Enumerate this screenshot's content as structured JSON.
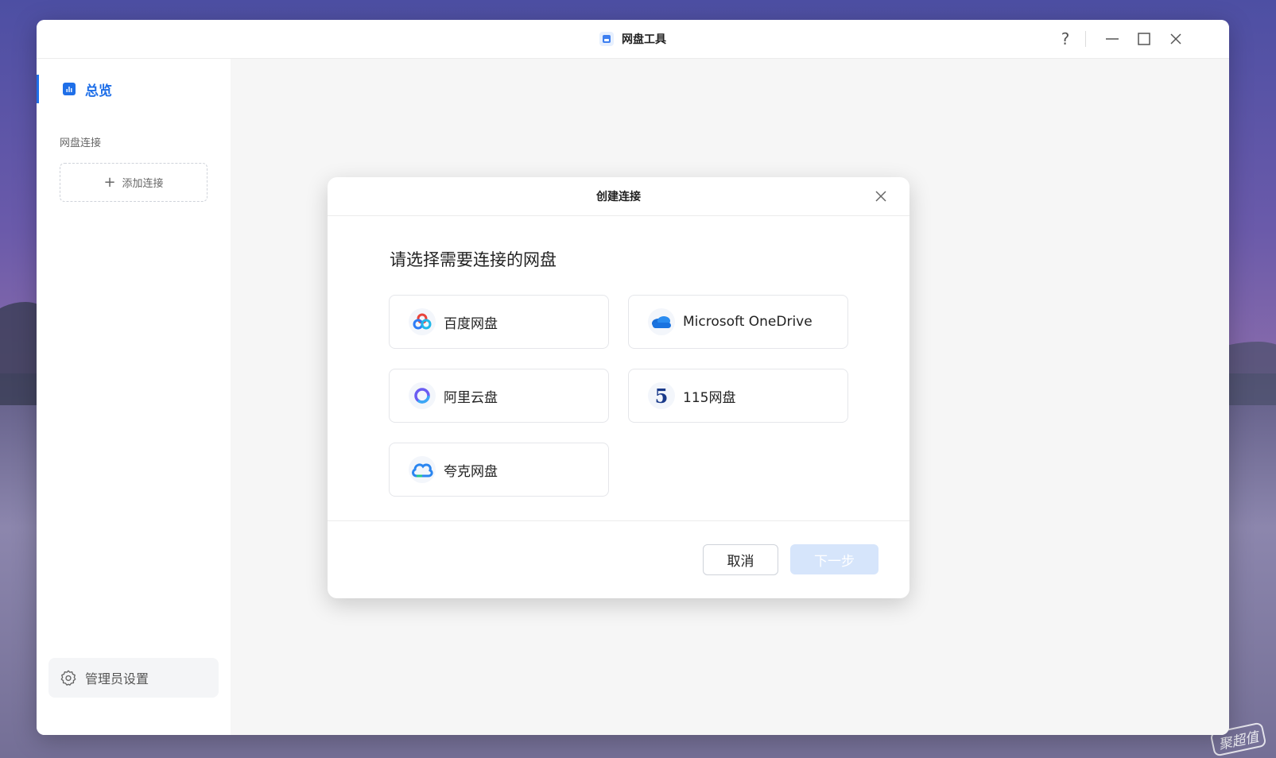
{
  "window": {
    "title": "网盘工具",
    "controls": {
      "help": "?",
      "minimize_icon": "minimize-icon",
      "maximize_icon": "maximize-icon",
      "close_icon": "close-icon"
    }
  },
  "sidebar": {
    "overview_label": "总览",
    "section_label": "网盘连接",
    "add_connection_label": "添加连接",
    "admin_settings_label": "管理员设置"
  },
  "modal": {
    "title": "创建连接",
    "prompt": "请选择需要连接的网盘",
    "providers": [
      {
        "name": "百度网盘",
        "icon": "baidu-netdisk-icon"
      },
      {
        "name": "Microsoft OneDrive",
        "icon": "onedrive-icon"
      },
      {
        "name": "阿里云盘",
        "icon": "aliyun-drive-icon"
      },
      {
        "name": "115网盘",
        "icon": "115-netdisk-icon"
      },
      {
        "name": "夸克网盘",
        "icon": "quark-netdisk-icon"
      }
    ],
    "cancel_label": "取消",
    "next_label": "下一步"
  },
  "desktop": {
    "watermark": "聚超值"
  },
  "colors": {
    "accent": "#1f6fe8",
    "next_disabled_bg": "#d6e5fb"
  }
}
